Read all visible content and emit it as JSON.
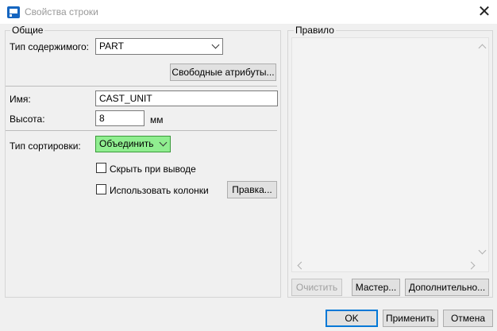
{
  "window": {
    "title": "Свойства строки",
    "close_glyph": "✕",
    "icon": "app-icon"
  },
  "general": {
    "group_title": "Общие",
    "content_type_label": "Тип содержимого:",
    "content_type_value": "PART",
    "free_attributes_label": "Свободные атрибуты...",
    "name_label": "Имя:",
    "name_value": "CAST_UNIT",
    "height_label": "Высота:",
    "height_value": "8",
    "height_unit": "мм",
    "sort_type_label": "Тип сортировки:",
    "sort_type_value": "Объединить",
    "sort_type_color": "#90ee90",
    "hide_on_output_label": "Скрыть при выводе",
    "hide_on_output_checked": false,
    "use_columns_label": "Использовать колонки",
    "use_columns_checked": false,
    "edit_label": "Правка..."
  },
  "rule": {
    "group_title": "Правило",
    "clear_label": "Очистить",
    "wizard_label": "Мастер...",
    "additional_label": "Дополнительно..."
  },
  "footer": {
    "ok_label": "OK",
    "apply_label": "Применить",
    "cancel_label": "Отмена"
  }
}
